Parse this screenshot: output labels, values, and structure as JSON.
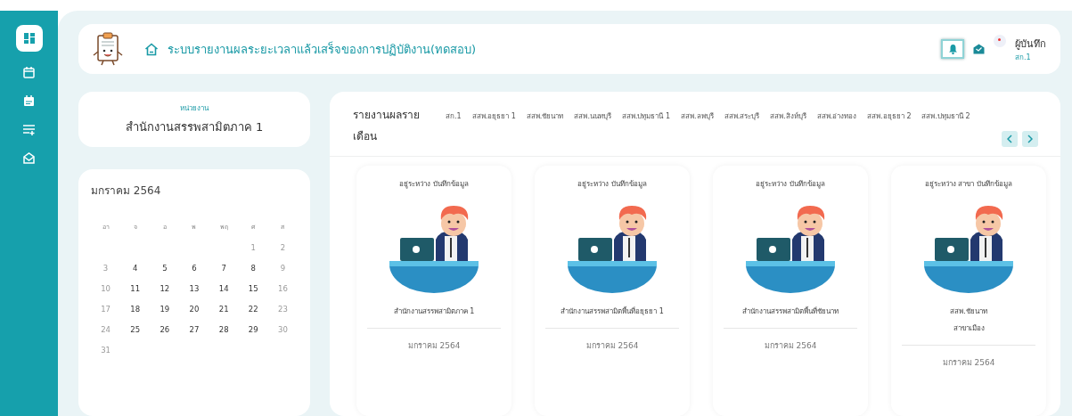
{
  "sidebar": {
    "items": [
      {
        "kind": "dashboard",
        "selected": true
      },
      {
        "kind": "calendar",
        "selected": false
      },
      {
        "kind": "schedule",
        "selected": false
      },
      {
        "kind": "addlist",
        "selected": false
      },
      {
        "kind": "mail",
        "selected": false
      }
    ]
  },
  "header": {
    "title": "ระบบรายงานผลระยะเวลาแล้วเสร็จของการปฏิบัติงาน(ทดสอบ)",
    "notification_active": true,
    "user_name": "ผู้บันทึก",
    "user_unit": "สก.1"
  },
  "unit": {
    "label": "หน่วยงาน",
    "value": "สำนักงานสรรพสามิตภาค 1"
  },
  "calendar": {
    "title": "มกราคม 2564",
    "weekdays": [
      "อา",
      "จ",
      "อ",
      "พ",
      "พฤ",
      "ศ",
      "ส"
    ],
    "days": [
      {
        "day": "1",
        "muted": true
      },
      {
        "day": "2",
        "muted": true
      },
      {
        "day": "3",
        "muted": true
      },
      {
        "day": "4",
        "muted": false
      },
      {
        "day": "5",
        "muted": false
      },
      {
        "day": "6",
        "muted": false
      },
      {
        "day": "7",
        "muted": false
      },
      {
        "day": "8",
        "muted": false
      },
      {
        "day": "9",
        "muted": true
      },
      {
        "day": "10",
        "muted": true
      },
      {
        "day": "11",
        "muted": false
      },
      {
        "day": "12",
        "muted": false
      },
      {
        "day": "13",
        "muted": false
      },
      {
        "day": "14",
        "muted": false
      },
      {
        "day": "15",
        "muted": false
      },
      {
        "day": "16",
        "muted": true
      },
      {
        "day": "17",
        "muted": true
      },
      {
        "day": "18",
        "muted": false
      },
      {
        "day": "19",
        "muted": false
      },
      {
        "day": "20",
        "muted": false
      },
      {
        "day": "21",
        "muted": false
      },
      {
        "day": "22",
        "muted": false
      },
      {
        "day": "23",
        "muted": true
      },
      {
        "day": "24",
        "muted": true
      },
      {
        "day": "25",
        "muted": false
      },
      {
        "day": "26",
        "muted": false
      },
      {
        "day": "27",
        "muted": false
      },
      {
        "day": "28",
        "muted": false
      },
      {
        "day": "29",
        "muted": false
      },
      {
        "day": "30",
        "muted": true
      },
      {
        "day": "31",
        "muted": true
      }
    ]
  },
  "report": {
    "title": "รายงานผลราย เดือน",
    "tabs": [
      "สก.1",
      "สสพ.อยุธยา 1",
      "สสพ.ชัยนาท",
      "สสพ.นนทบุรี",
      "สสพ.ปทุมธานี 1",
      "สสพ.ลพบุรี",
      "สสพ.สระบุรี",
      "สสพ.สิงห์บุรี",
      "สสพ.อ่างทอง",
      "สสพ.อยุธยา 2",
      "สสพ.ปทุมธานี 2"
    ],
    "cards": [
      {
        "status": "อยู่ระหว่าง บันทึกข้อมูล",
        "office": [
          "สำนักงานสรรพสามิตภาค 1"
        ],
        "month": "มกราคม 2564"
      },
      {
        "status": "อยู่ระหว่าง บันทึกข้อมูล",
        "office": [
          "สำนักงานสรรพสามิตพื้นที่อยุธยา 1"
        ],
        "month": "มกราคม 2564"
      },
      {
        "status": "อยู่ระหว่าง บันทึกข้อมูล",
        "office": [
          "สำนักงานสรรพสามิตพื้นที่ชัยนาท"
        ],
        "month": "มกราคม 2564"
      },
      {
        "status": "อยู่ระหว่าง สาขา บันทึกข้อมูล",
        "office": [
          "สสพ.ชัยนาท",
          "สาขาเมือง"
        ],
        "month": "มกราคม 2564"
      }
    ]
  }
}
